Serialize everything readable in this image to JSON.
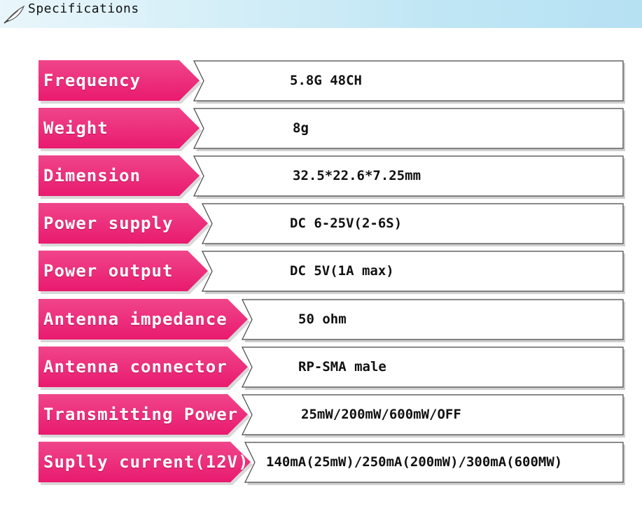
{
  "header": {
    "title": "Specifications",
    "icon": "feather-pen-icon"
  },
  "colors": {
    "label_bg": "#e91a6f",
    "label_bg_light": "#f0458a",
    "value_border": "#444444",
    "header_bg": "#bfe6f4"
  },
  "specs": [
    {
      "label": "Frequency",
      "value": "5.8G 48CH"
    },
    {
      "label": "Weight",
      "value": "8g"
    },
    {
      "label": "Dimension",
      "value": "32.5*22.6*7.25mm"
    },
    {
      "label": "Power supply",
      "value": "DC 6-25V(2-6S)"
    },
    {
      "label": "Power output",
      "value": "DC 5V(1A max)"
    },
    {
      "label": "Antenna impedance",
      "value": "50 ohm"
    },
    {
      "label": "Antenna connector",
      "value": "RP-SMA male"
    },
    {
      "label": "Transmitting Power",
      "value": "25mW/200mW/600mW/OFF"
    },
    {
      "label": "Suplly current(12V)",
      "value": "140mA(25mW)/250mA(200mW)/300mA(600MW)"
    }
  ]
}
